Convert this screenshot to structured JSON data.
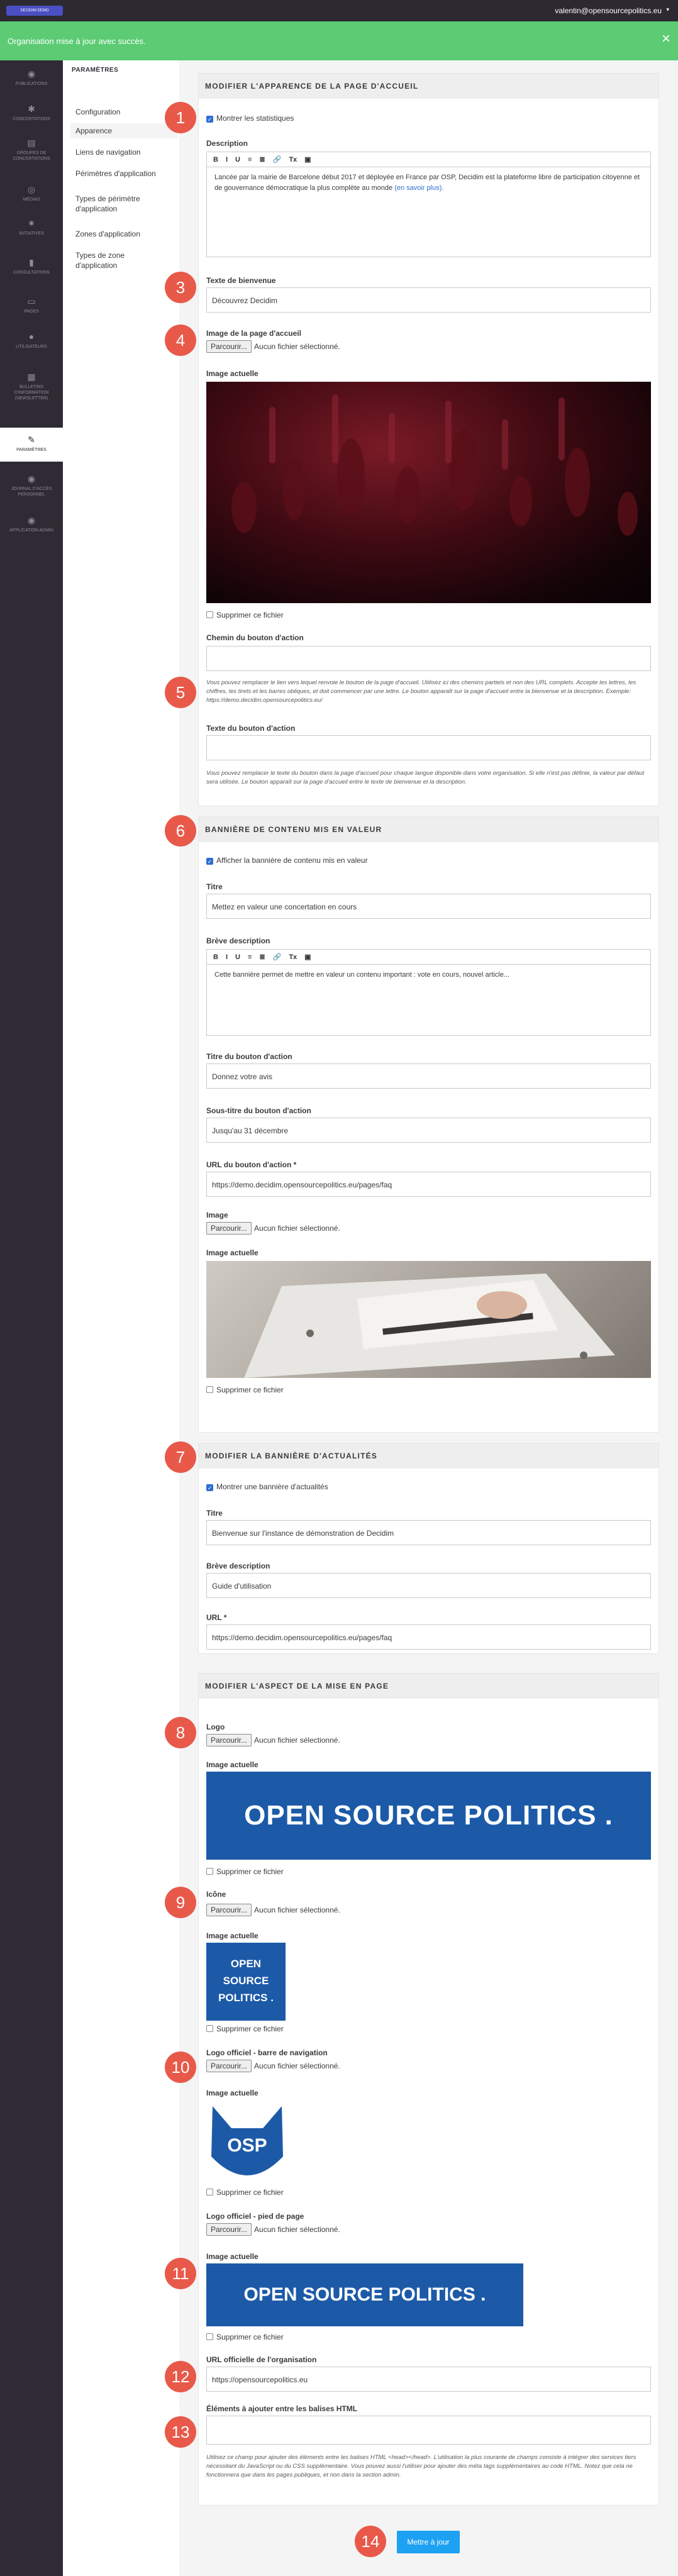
{
  "topbar": {
    "logo_label": "DECIDIM DEMO",
    "user": "valentin@opensourcepolitics.eu",
    "caret": "▾"
  },
  "flash": {
    "message": "Organisation mise à jour avec succès.",
    "close": "×"
  },
  "sidebar": {
    "items": [
      {
        "label": "PUBLICATIONS",
        "icon": "bullhorn-icon",
        "glyph": "◉"
      },
      {
        "label": "CONCERTATIONS",
        "icon": "gear-icon",
        "glyph": "✱"
      },
      {
        "label": "GROUPES DE CONCERTATIONS",
        "icon": "group-icon",
        "glyph": "▤"
      },
      {
        "label": "MÉDIAS",
        "icon": "broadcast-icon",
        "glyph": "◎"
      },
      {
        "label": "INITIATIVES",
        "icon": "sun-icon",
        "glyph": "✷"
      },
      {
        "label": "CONSULTATIONS",
        "icon": "chat-icon",
        "glyph": "▮"
      },
      {
        "label": "PAGES",
        "icon": "page-icon",
        "glyph": "▭"
      },
      {
        "label": "UTILISATEURS",
        "icon": "user-icon",
        "glyph": "●"
      },
      {
        "label": "BULLETINS D'INFORMATION (NEWSLETTER)",
        "icon": "newsletter-icon",
        "glyph": "▦"
      },
      {
        "label": "PARAMÈTRES",
        "icon": "wrench-icon",
        "glyph": "✎"
      },
      {
        "label": "JOURNAL D'ACCÈS PERSONNEL",
        "icon": "log-icon",
        "glyph": "◉"
      },
      {
        "label": "APPLICATION ADMIN",
        "icon": "app-icon",
        "glyph": "◉"
      }
    ]
  },
  "secondary": {
    "title": "PARAMÈTRES",
    "links": [
      "Configuration",
      "Apparence",
      "Liens de navigation",
      "Périmètres d'application",
      "Types de périmètre d'application",
      "Zones d'application",
      "Types de zone d'application"
    ]
  },
  "appearance": {
    "header": "MODIFIER L'APPARENCE DE LA PAGE D'ACCUEIL",
    "show_stats": "Montrer les statistiques",
    "description_label": "Description",
    "toolbar": [
      "B",
      "I",
      "U",
      "≡",
      "≣",
      "🔗",
      "Tx",
      "▣"
    ],
    "description_text": "Lancée par la mairie de Barcelone début 2017 et déployée en France par OSP, Decidim est la plateforme libre de participation citoyenne et de gouvernance démocratique la plus complète au monde ",
    "description_link": "(en savoir plus).",
    "welcome_label": "Texte de bienvenue",
    "welcome_value": "Découvrez Decidim",
    "homepage_image_label": "Image de la page d'accueil",
    "browse": "Parcourir...",
    "no_file": "Aucun fichier sélectionné.",
    "current_image": "Image actuelle",
    "remove_file": "Supprimer ce fichier",
    "cta_path_label": "Chemin du bouton d'action",
    "cta_path_help": "Vous pouvez remplacer le lien vers lequel renvoie le bouton de la page d'accueil. Utilisez ici des chemins partiels et non des URL complets. Accepte les lettres, les chiffres, les tirets et les barres obliques, et doit commencer par une lettre. Le bouton apparaît sur la page d'accueil entre la bienvenue et la description. Exemple: https://demo.decidim.opensourcepolitics.eu/",
    "cta_text_label": "Texte du bouton d'action",
    "cta_text_help": "Vous pouvez remplacer le texte du bouton dans la page d'accueil pour chaque langue disponible dans votre organisation. Si elle n'est pas définie, la valeur par défaut sera utilisée. Le bouton apparaît sur la page d'accueil entre le texte de bienvenue et la description."
  },
  "highlighted": {
    "header": "BANNIÈRE DE CONTENU MIS EN VALEUR",
    "enable": "Afficher la bannière de contenu mis en valeur",
    "title_label": "Titre",
    "title_value": "Mettez en valeur une concertation en cours",
    "short_desc_label": "Brève description",
    "short_desc_value": "Cette bannière permet de mettre en valeur un contenu important : vote en cours, nouvel article...",
    "action_title_label": "Titre du bouton d'action",
    "action_title_value": "Donnez votre avis",
    "action_sub_label": "Sous-titre du bouton d'action",
    "action_sub_value": "Jusqu'au 31 décembre",
    "action_url_label": "URL du bouton d'action *",
    "action_url_value": "https://demo.decidim.opensourcepolitics.eu/pages/faq",
    "image_label": "Image",
    "current_image": "Image actuelle",
    "remove_file": "Supprimer ce fichier"
  },
  "news": {
    "header": "MODIFIER LA BANNIÈRE D'ACTUALITÉS",
    "enable": "Montrer une bannière d'actualités",
    "title_label": "Titre",
    "title_value": "Bienvenue sur l'instance de démonstration de Decidim",
    "short_desc_label": "Brève description",
    "short_desc_value": "Guide d'utilisation",
    "url_label": "URL *",
    "url_value": "https://demo.decidim.opensourcepolitics.eu/pages/faq"
  },
  "layout": {
    "header": "MODIFIER L'ASPECT DE LA MISE EN PAGE",
    "logo_label": "Logo",
    "current_image": "Image actuelle",
    "remove_file": "Supprimer ce fichier",
    "logo_text": "OPEN SOURCE POLITICS .",
    "icon_label": "Icône",
    "icon_text_lines": [
      "OPEN",
      "SOURCE",
      "POLITICS ."
    ],
    "nav_logo_label": "Logo officiel - barre de navigation",
    "nav_logo_text": "OSP",
    "footer_logo_label": "Logo officiel - pied de page",
    "footer_logo_text": "OPEN SOURCE POLITICS .",
    "org_url_label": "URL officielle de l'organisation",
    "org_url_value": "https://opensourcepolitics.eu",
    "header_html_label": "Éléments à ajouter entre les balises HTML",
    "header_html_help": "Utilisez ce champ pour ajouter des éléments entre les balises HTML <head></head>. L'utilisation la plus courante de champs consiste à intégrer des services tiers nécessitant du JavaScript ou du CSS supplémentaire. Vous pouvez aussi l'utiliser pour ajouter des méta tags supplémentaires au code HTML. Notez que cela ne fonctionnera que dans les pages publiques, et non dans la section admin."
  },
  "save_label": "Mettre à jour",
  "markers": [
    "1",
    "3",
    "4",
    "5",
    "6",
    "7",
    "8",
    "9",
    "10",
    "11",
    "12",
    "13",
    "14"
  ],
  "colors": {
    "flash": "#5ccb74",
    "marker": "#e8594a",
    "brand": "#1c5aa8",
    "sidebar": "#2f2b34",
    "primary_button": "#1da1f2"
  }
}
